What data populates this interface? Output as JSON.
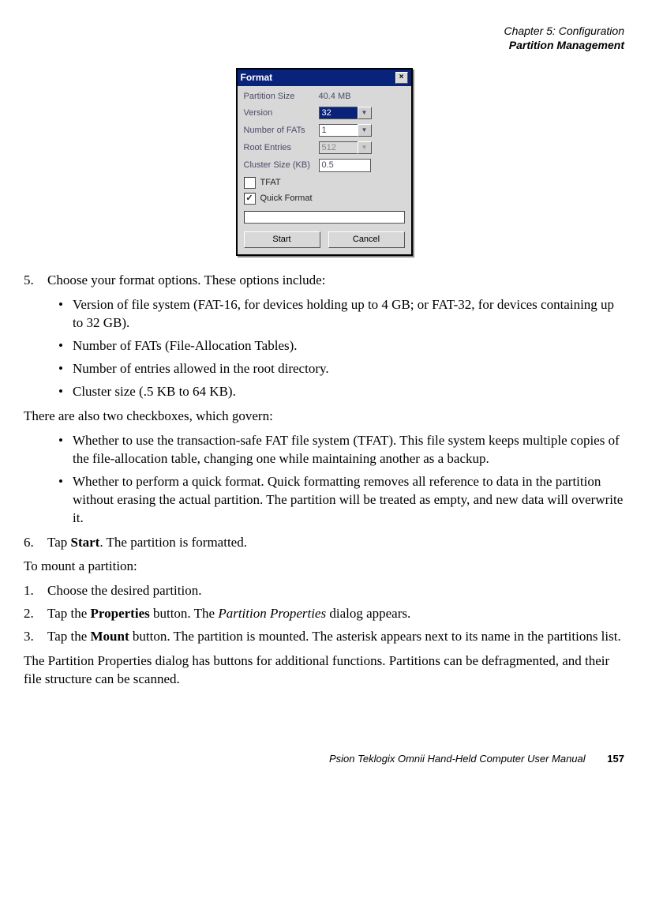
{
  "header": {
    "chapter": "Chapter 5: Configuration",
    "section": "Partition Management"
  },
  "dialog": {
    "title": "Format",
    "close_x": "×",
    "labels": {
      "partition_size": "Partition Size",
      "version": "Version",
      "num_fats": "Number of FATs",
      "root_entries": "Root Entries",
      "cluster_size": "Cluster Size (KB)"
    },
    "values": {
      "partition_size": "40.4 MB",
      "version": "32",
      "num_fats": "1",
      "root_entries": "512",
      "cluster_size": "0.5"
    },
    "check_tfat": "TFAT",
    "check_quick": "Quick Format",
    "checkmark": "✓",
    "btn_start": "Start",
    "btn_cancel": "Cancel",
    "dropdown_glyph": "▼"
  },
  "body": {
    "step5_num": "5.",
    "step5_text": "Choose your format options. These options include:",
    "bullets1": [
      "Version of file system (FAT-16, for devices holding up to 4 GB; or FAT-32, for devices containing up to 32 GB).",
      "Number of FATs (File-Allocation Tables).",
      "Number of entries allowed in the root directory.",
      "Cluster size (.5 KB to 64 KB)."
    ],
    "para_checkboxes": "There are also two checkboxes, which govern:",
    "bullets2": [
      "Whether to use the transaction-safe FAT file system (TFAT). This file system keeps multiple copies of the file-allocation table, changing one while maintaining another as a backup.",
      "Whether to perform a quick format. Quick formatting removes all reference to data in the partition without erasing the actual partition. The partition will be treated as empty, and new data will overwrite it."
    ],
    "step6_num": "6.",
    "step6_pre": "Tap ",
    "step6_bold": "Start",
    "step6_post": ". The partition is formatted.",
    "para_mount": "To mount a partition:",
    "m1_num": "1.",
    "m1_text": "Choose the desired partition.",
    "m2_num": "2.",
    "m2_pre": "Tap the ",
    "m2_bold": "Properties",
    "m2_mid": " button. The ",
    "m2_ital": "Partition Properties",
    "m2_post": " dialog appears.",
    "m3_num": "3.",
    "m3_pre": "Tap the ",
    "m3_bold": "Mount",
    "m3_post": " button. The partition is mounted. The asterisk appears next to its name in the partitions list.",
    "para_final": "The Partition Properties dialog has buttons for additional functions. Partitions can be defragmented, and their file structure can be scanned."
  },
  "footer": {
    "manual": "Psion Teklogix Omnii Hand-Held Computer User Manual",
    "page": "157"
  }
}
